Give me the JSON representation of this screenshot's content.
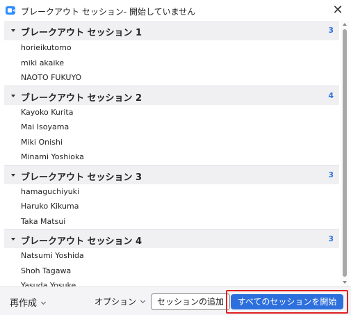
{
  "window": {
    "title": "ブレークアウト セッション- 開始していません",
    "close_glyph": "✕"
  },
  "sessions": [
    {
      "name": "ブレークアウト セッション 1",
      "count": "3",
      "members": [
        "horieikutomo",
        "miki akaike",
        "NAOTO FUKUYO"
      ]
    },
    {
      "name": "ブレークアウト セッション 2",
      "count": "4",
      "members": [
        "Kayoko Kurita",
        "Mai Isoyama",
        "Miki Onishi",
        "Minami Yoshioka"
      ]
    },
    {
      "name": "ブレークアウト セッション 3",
      "count": "3",
      "members": [
        "hamaguchiyuki",
        "Haruko Kikuma",
        "Taka Matsui"
      ]
    },
    {
      "name": "ブレークアウト セッション 4",
      "count": "3",
      "members": [
        "Natsumi Yoshida",
        "Shoh Tagawa",
        "Yasuda Yosuke"
      ]
    }
  ],
  "footer": {
    "recreate_label": "再作成",
    "options_label": "オプション",
    "add_session_label": "セッションの追加",
    "start_all_label": "すべてのセッションを開始"
  },
  "colors": {
    "accent": "#2d6fdc",
    "highlight_border": "#e02020",
    "section_bg": "#f0f0f3"
  },
  "icons": {
    "app": "zoom-camera-icon",
    "close": "close-icon",
    "section_toggle": "caret-down-icon",
    "dropdown": "chevron-down-icon"
  }
}
